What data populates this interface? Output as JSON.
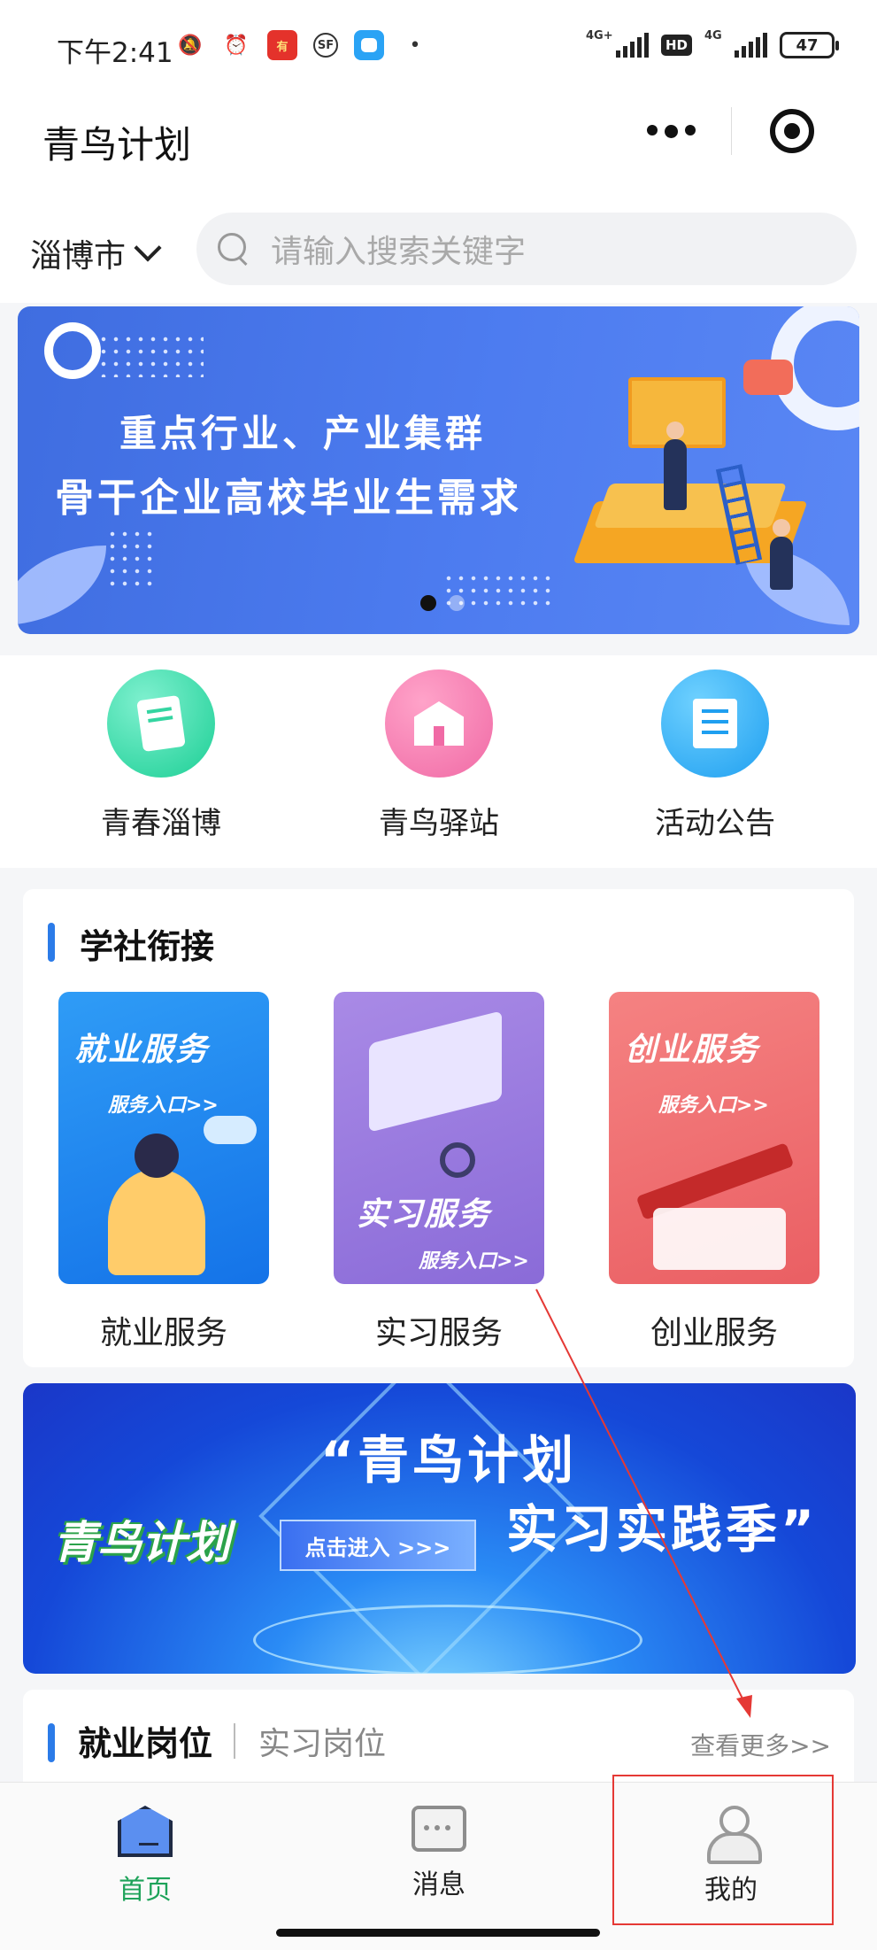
{
  "status_bar": {
    "time": "下午2:41",
    "icons": [
      "mute-icon",
      "alarm-icon",
      "app-icon-red",
      "sf-icon",
      "app-icon-blue",
      "dot-icon"
    ],
    "app_red_text": "有",
    "sf_text": "SF",
    "signal1_tag": "4G+",
    "hd": "HD",
    "signal2_tag": "4G",
    "battery": "47"
  },
  "nav": {
    "title": "青鸟计划"
  },
  "search": {
    "city": "淄博市",
    "placeholder": "请输入搜索关键字"
  },
  "banner": {
    "line1": "重点行业、产业集群",
    "line2": "骨干企业高校毕业生需求",
    "page_count": 2,
    "active_index": 0
  },
  "quick_entries": [
    {
      "label": "青春淄博",
      "icon": "book-icon",
      "color": "#1ccf95"
    },
    {
      "label": "青鸟驿站",
      "icon": "building-icon",
      "color": "#f06aa5"
    },
    {
      "label": "活动公告",
      "icon": "notice-icon",
      "color": "#1f9ff0"
    }
  ],
  "section": {
    "title": "学社衔接",
    "services": [
      {
        "title": "就业服务",
        "image_heading": "就业服务",
        "image_sub": "服务入口>>"
      },
      {
        "title": "实习服务",
        "image_heading": "实习服务",
        "image_sub": "服务入口>>"
      },
      {
        "title": "创业服务",
        "image_heading": "创业服务",
        "image_sub": "服务入口>>"
      }
    ]
  },
  "promo": {
    "logo": "青鸟计划",
    "quote1": "“青鸟计划",
    "quote2": "实习实践季”",
    "button": "点击进入 >>>"
  },
  "jobs": {
    "tab_active": "就业岗位",
    "tab_inactive": "实习岗位",
    "more": "查看更多>>"
  },
  "tabbar": {
    "items": [
      {
        "label": "首页",
        "icon": "home-icon",
        "active": true
      },
      {
        "label": "消息",
        "icon": "message-icon",
        "active": false
      },
      {
        "label": "我的",
        "icon": "user-icon",
        "active": false
      }
    ],
    "active_color": "#1ea35a"
  },
  "annotation": {
    "color": "#e53935",
    "highlighted_tab": "我的"
  }
}
